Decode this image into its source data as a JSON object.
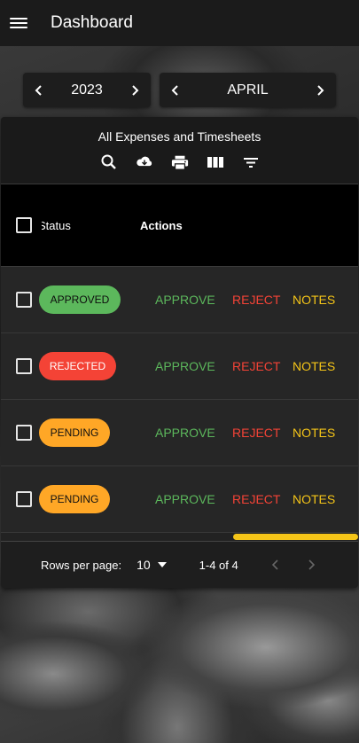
{
  "appbar": {
    "title": "Dashboard",
    "menu_icon": "hamburger-menu-icon"
  },
  "year_selector": {
    "value": "2023",
    "prev_icon": "chevron-left-icon",
    "next_icon": "chevron-right-icon"
  },
  "month_selector": {
    "value": "APRIL",
    "prev_icon": "chevron-left-icon",
    "next_icon": "chevron-right-icon"
  },
  "table": {
    "title": "All Expenses and Timesheets",
    "toolbar": [
      "search-icon",
      "download-icon",
      "print-icon",
      "view-columns-icon",
      "filter-icon"
    ],
    "columns": {
      "status": "Status",
      "actions": "Actions"
    },
    "rows": [
      {
        "status": "APPROVED",
        "approve": "APPROVE",
        "reject": "REJECT",
        "notes": "NOTES"
      },
      {
        "status": "REJECTED",
        "approve": "APPROVE",
        "reject": "REJECT",
        "notes": "NOTES"
      },
      {
        "status": "PENDING",
        "approve": "APPROVE",
        "reject": "REJECT",
        "notes": "NOTES"
      },
      {
        "status": "PENDING",
        "approve": "APPROVE",
        "reject": "REJECT",
        "notes": "NOTES"
      }
    ]
  },
  "pagination": {
    "rows_per_page_label": "Rows per page:",
    "rows_per_page_value": "10",
    "range": "1-4 of 4"
  },
  "colors": {
    "approved": "#5cb85c",
    "rejected": "#f44336",
    "pending": "#ffa726",
    "notes": "#f5c518"
  }
}
